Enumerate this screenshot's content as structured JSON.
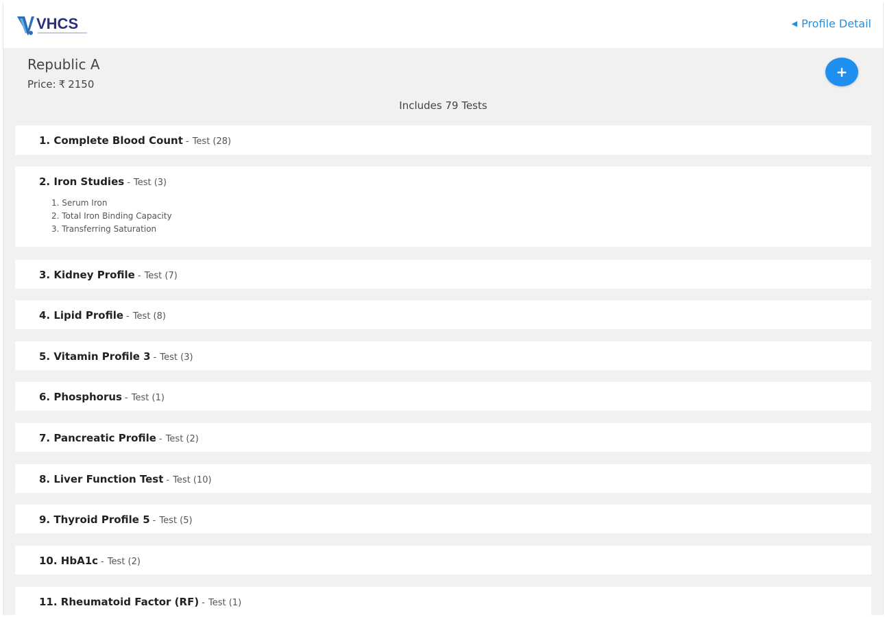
{
  "header": {
    "logo_text": "VHCS",
    "profile_link": "Profile Detail"
  },
  "package": {
    "name": "Republic A",
    "price_label": "Price:",
    "currency_symbol": "₹",
    "price_value": "2150",
    "includes_text": "Includes 79 Tests",
    "add_button_label": "+"
  },
  "tests": [
    {
      "name": "1. Complete Blood Count",
      "sep": "-",
      "count": "Test (28)"
    },
    {
      "name": "2. Iron Studies",
      "sep": "-",
      "count": "Test (3)",
      "sub_items": [
        "1. Serum Iron",
        "2. Total Iron Binding Capacity",
        "3. Transferring Saturation"
      ]
    },
    {
      "name": "3. Kidney Profile",
      "sep": "-",
      "count": "Test (7)"
    },
    {
      "name": "4. Lipid Profile",
      "sep": "-",
      "count": "Test (8)"
    },
    {
      "name": "5. Vitamin Profile 3",
      "sep": "-",
      "count": "Test (3)"
    },
    {
      "name": "6. Phosphorus",
      "sep": "-",
      "count": "Test (1)"
    },
    {
      "name": "7. Pancreatic Profile",
      "sep": "-",
      "count": "Test (2)"
    },
    {
      "name": "8. Liver Function Test",
      "sep": "-",
      "count": "Test (10)"
    },
    {
      "name": "9. Thyroid Profile 5",
      "sep": "-",
      "count": "Test (5)"
    },
    {
      "name": "10. HbA1c",
      "sep": "-",
      "count": "Test (2)"
    },
    {
      "name": "11. Rheumatoid Factor (RF)",
      "sep": "-",
      "count": "Test (1)"
    }
  ]
}
